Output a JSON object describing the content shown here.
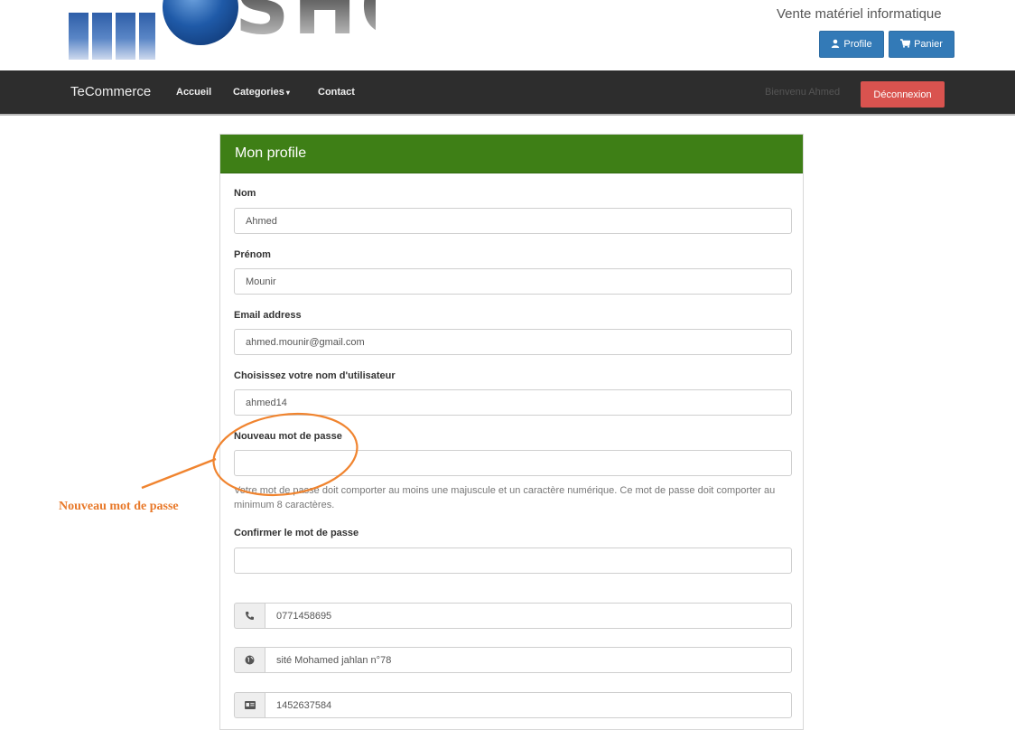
{
  "header": {
    "logo_text": "SHOP",
    "tagline": "Vente matériel informatique",
    "profile_label": "Profile",
    "cart_label": "Panier",
    "profile_icon": "user-icon",
    "cart_icon": "cart-icon"
  },
  "navbar": {
    "brand": "TeCommerce",
    "links": [
      "Accueil",
      "Categories",
      "Contact"
    ],
    "welcome": "Bienvenu Ahmed",
    "logout_label": "Déconnexion"
  },
  "panel": {
    "title": "Mon profile",
    "fields": {
      "nom": {
        "label": "Nom",
        "value": "Ahmed"
      },
      "prenom": {
        "label": "Prénom",
        "value": "Mounir"
      },
      "email": {
        "label": "Email address",
        "value": "ahmed.mounir@gmail.com"
      },
      "username": {
        "label": "Choisissez votre nom d'utilisateur",
        "value": "ahmed14"
      },
      "password": {
        "label": "Nouveau mot de passe",
        "value": ""
      },
      "confirm": {
        "label": "Confirmer le mot de passe",
        "value": ""
      }
    },
    "password_help": "Votre mot de passe doit comporter au moins une majuscule et un caractère numérique. Ce mot de passe doit comporter au minimum 8 caractères.",
    "phone": "0771458695",
    "address": "sité Mohamed jahlan n°78",
    "card": "1452637584"
  },
  "annotation": {
    "text": "Nouveau mot de passe",
    "color": "#e8792a"
  },
  "colors": {
    "panel_heading": "#3e7f16",
    "primary": "#337ab7",
    "danger": "#d9534f",
    "navbar": "#2d2d2d"
  }
}
